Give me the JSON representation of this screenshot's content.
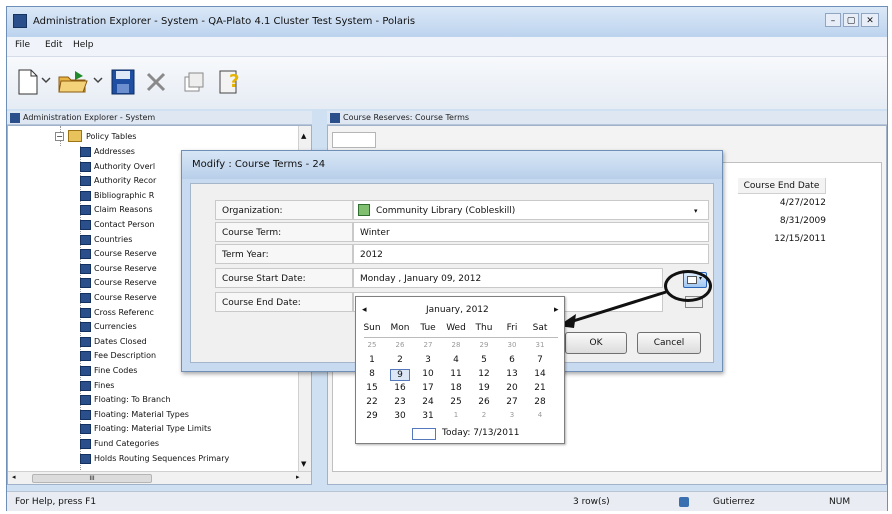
{
  "window": {
    "title": "Administration Explorer - System - QA-Plato 4.1 Cluster Test System - Polaris",
    "controls": [
      "–",
      "▢",
      "✕"
    ]
  },
  "menu": [
    "File",
    "Edit",
    "Help"
  ],
  "tree_pane": {
    "title": "Administration Explorer - System",
    "root": "Policy Tables",
    "items": [
      "Addresses",
      "Authority Overl",
      "Authority Recor",
      "Bibliographic R",
      "Claim Reasons",
      "Contact Person",
      "Countries",
      "Course Reserve",
      "Course Reserve",
      "Course Reserve",
      "Course Reserve",
      "Cross Referenc",
      "Currencies",
      "Dates Closed",
      "Fee Description",
      "Fine Codes",
      "Fines",
      "Floating: To Branch",
      "Floating: Material Types",
      "Floating: Material Type Limits",
      "Fund Categories",
      "Holds Routing Sequences Primary"
    ],
    "scroll_label": "III"
  },
  "right_pane": {
    "title": "Course Reserves: Course Terms",
    "column_header": "Course End Date",
    "rows": [
      "4/27/2012",
      "8/31/2009",
      "12/15/2011"
    ]
  },
  "dialog": {
    "title": "Modify : Course Terms - 24",
    "fields": [
      {
        "label": "Organization:",
        "value": "Community Library (Cobleskill)"
      },
      {
        "label": "Course Term:",
        "value": "Winter"
      },
      {
        "label": "Term Year:",
        "value": "2012"
      },
      {
        "label": "Course Start Date:",
        "value": "Monday  ,  January  09, 2012"
      },
      {
        "label": "Course End Date:",
        "value": ""
      }
    ],
    "ok_label": "OK",
    "cancel_label": "Cancel"
  },
  "calendar": {
    "month_label": "January, 2012",
    "prev": "◂",
    "next": "▸",
    "weekdays": [
      "Sun",
      "Mon",
      "Tue",
      "Wed",
      "Thu",
      "Fri",
      "Sat"
    ],
    "weeks": [
      [
        "25",
        "26",
        "27",
        "28",
        "29",
        "30",
        "31"
      ],
      [
        "1",
        "2",
        "3",
        "4",
        "5",
        "6",
        "7"
      ],
      [
        "8",
        "9",
        "10",
        "11",
        "12",
        "13",
        "14"
      ],
      [
        "15",
        "16",
        "17",
        "18",
        "19",
        "20",
        "21"
      ],
      [
        "22",
        "23",
        "24",
        "25",
        "26",
        "27",
        "28"
      ],
      [
        "29",
        "30",
        "31",
        "1",
        "2",
        "3",
        "4"
      ]
    ],
    "selected": "9",
    "today_label": "Today: 7/13/2011"
  },
  "status": {
    "help": "For Help, press F1",
    "rows": "3 row(s)",
    "user": "Gutierrez",
    "num": "NUM"
  },
  "colors": {
    "annotation": "#111111",
    "accent": "#2a5aa6",
    "selection": "#5577bb"
  }
}
